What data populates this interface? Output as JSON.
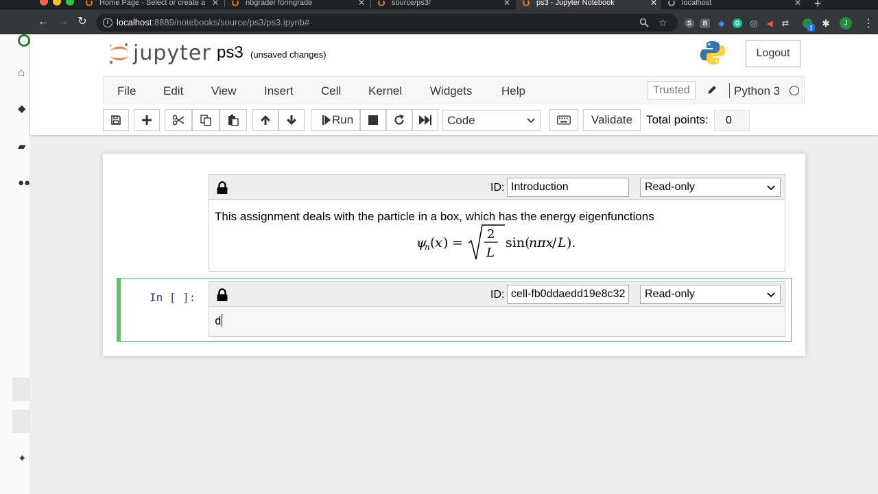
{
  "browser": {
    "tabs": [
      {
        "title": "Home Page - Select or create a"
      },
      {
        "title": "nbgrader formgrade"
      },
      {
        "title": "source/ps3/"
      },
      {
        "title": "ps3 - Jupyter Notebook"
      },
      {
        "title": "localhost"
      }
    ],
    "url_host": "localhost",
    "url_rest": ":8889/notebooks/source/ps3/ps3.ipynb#",
    "profile_initial": "J",
    "ext_badge": "1"
  },
  "header": {
    "logo_text": "jupyter",
    "notebook_title": "ps3",
    "save_status": "(unsaved changes)",
    "logout_label": "Logout"
  },
  "menu": {
    "items": [
      "File",
      "Edit",
      "View",
      "Insert",
      "Cell",
      "Kernel",
      "Widgets",
      "Help"
    ],
    "trusted_label": "Trusted",
    "kernel_name": "Python 3"
  },
  "toolbar": {
    "run_label": "Run",
    "cell_type": "Code",
    "validate_label": "Validate",
    "total_points_label": "Total points:",
    "total_points_value": "0"
  },
  "cells": [
    {
      "id_label": "ID:",
      "id_value": "Introduction",
      "mode": "Read-only",
      "text": "This assignment deals with the particle in a box, which has the energy eigenfunctions"
    },
    {
      "prompt": "In [ ]:",
      "id_label": "ID:",
      "id_value": "cell-fb0ddaedd19e8c32",
      "mode": "Read-only",
      "code": "d"
    }
  ],
  "colors": {
    "jupyter_orange": "#f37726",
    "selected_cell_green": "#66bb6a",
    "prompt_blue": "#303f9f"
  }
}
